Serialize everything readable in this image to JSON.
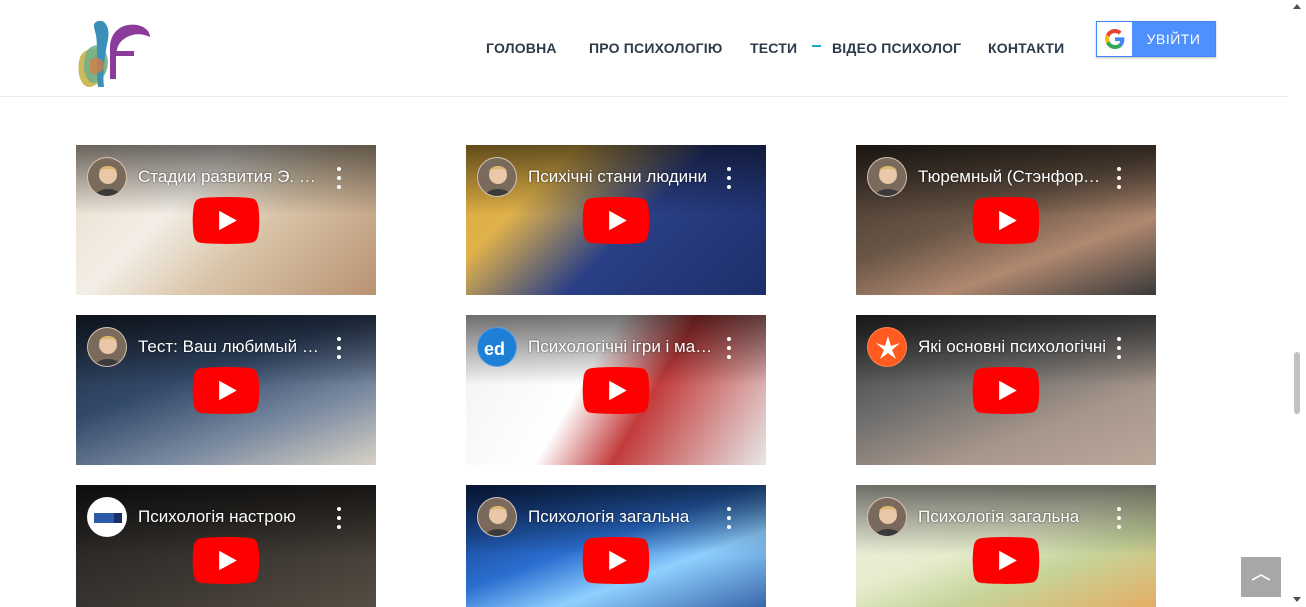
{
  "nav": {
    "items": [
      {
        "label": "ГОЛОВНА"
      },
      {
        "label": "ПРО ПСИХОЛОГІЮ"
      },
      {
        "label": "ТЕСТИ"
      },
      {
        "label": "ВІДЕО ПСИХОЛОГ"
      },
      {
        "label": "КОНТАКТИ"
      }
    ],
    "login_label": "УВІЙТИ",
    "login_icon": "google-g-icon"
  },
  "colors": {
    "accent": "#1aa7c9",
    "login_blue": "#4d90fe",
    "youtube_red": "#ff0000",
    "nav_text": "#2d3a4a"
  },
  "videos": [
    {
      "title": "Стадии развития Э. Эриксона",
      "channel_icon": "psychologist-avatar"
    },
    {
      "title": "Психічні стани людини",
      "channel_icon": "psychologist-avatar"
    },
    {
      "title": "Тюремный (Стэнфордский) эксперимент",
      "channel_icon": "psychologist-avatar"
    },
    {
      "title": "Тест: Ваш любимый пейзаж",
      "channel_icon": "psychologist-avatar"
    },
    {
      "title": "Психологічні ігри і маніпуляції",
      "channel_icon": "ed-channel-logo"
    },
    {
      "title": "Які основні психологічні",
      "channel_icon": "radio-svoboda-logo"
    },
    {
      "title": "Психологія настрою",
      "channel_icon": "dnipro-tv-logo"
    },
    {
      "title": "Психологія загальна",
      "channel_icon": "psychologist-avatar"
    },
    {
      "title": "Психологія загальна",
      "channel_icon": "psychologist-avatar"
    }
  ]
}
